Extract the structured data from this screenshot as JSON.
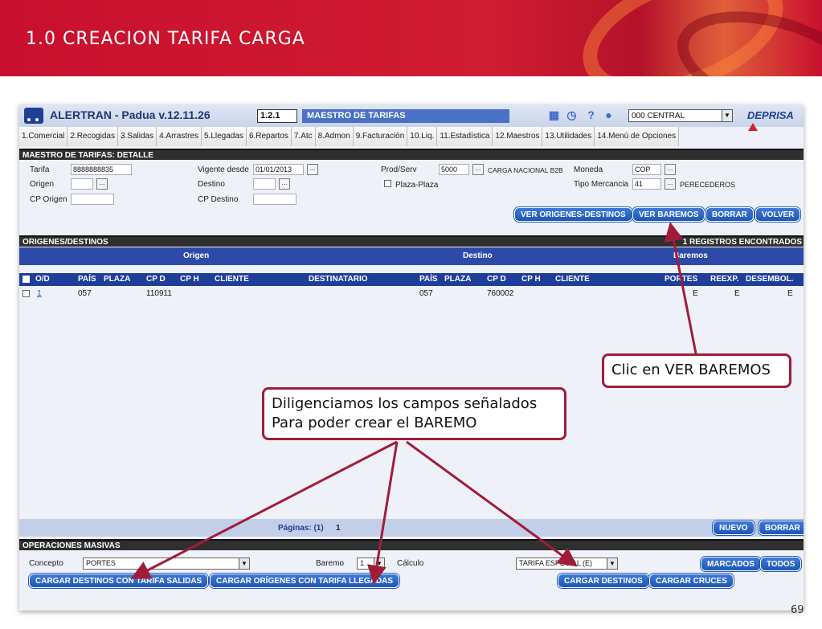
{
  "banner": {
    "title": "1.0 CREACION TARIFA CARGA"
  },
  "app": {
    "title": "ALERTRAN - Padua  v.12.11.26",
    "code": "1.2.1",
    "module": "MAESTRO DE TARIFAS",
    "office": "000 CENTRAL",
    "brand": "DEPRISA"
  },
  "menu": [
    "1.Comercial",
    "2.Recogidas",
    "3.Salidas",
    "4.Arrastres",
    "5.Llegadas",
    "6.Repartos",
    "7.Atc",
    "8.Admon",
    "9.Facturación",
    "10.Liq.",
    "11.Estadística",
    "12.Maestros",
    "13.Utilidades",
    "14.Menú de Opciones"
  ],
  "detail": {
    "header": "MAESTRO DE TARIFAS: DETALLE",
    "tarifa_label": "Tarifa",
    "tarifa_value": "8888888835",
    "origen_label": "Origen",
    "cp_origen_label": "CP Origen",
    "vigente_label": "Vigente desde",
    "vigente_value": "01/01/2013",
    "destino_label": "Destino",
    "cp_destino_label": "CP Destino",
    "prodserv_label": "Prod/Serv",
    "prodserv_value": "5000",
    "prodserv_desc": "CARGA NACIONAL B2B",
    "plaza_label": "Plaza-Plaza",
    "moneda_label": "Moneda",
    "moneda_value": "COP",
    "tipo_label": "Tipo Mercancia",
    "tipo_value": "41",
    "tipo_desc": "PERECEDEROS",
    "btn_origenes": "VER ORIGENES-DESTINOS",
    "btn_baremos": "VER BAREMOS",
    "btn_borrar": "BORRAR",
    "btn_volver": "VOLVER"
  },
  "grid": {
    "header": "ORIGENES/DESTINOS",
    "count": "1 REGISTROS ENCONTRADOS",
    "group_origen": "Origen",
    "group_destino": "Destino",
    "group_baremos": "Baremos",
    "columns": [
      "O/D",
      "PAÍS",
      "PLAZA",
      "CP D",
      "CP H",
      "CLIENTE",
      "DESTINATARIO",
      "PAÍS",
      "PLAZA",
      "CP D",
      "CP H",
      "CLIENTE",
      "PORTES",
      "REEXP.",
      "DESEMBOL."
    ],
    "row": {
      "od": "1",
      "pais_o": "057",
      "cpd_o": "110911",
      "pais_d": "057",
      "cpd_d": "760002",
      "portes": "E",
      "reexp": "E",
      "desembol": "E"
    },
    "pages_label": "Páginas: (1)",
    "page": "1",
    "btn_nuevo": "NUEVO",
    "btn_borrar": "BORRAR"
  },
  "mass": {
    "header": "OPERACIONES MASIVAS",
    "concepto_label": "Concepto",
    "concepto_value": "PORTES",
    "baremo_label": "Baremo",
    "baremo_value": "1",
    "calculo_label": "Cálculo",
    "calculo_value": "TARIFA ESPECIAL (E)",
    "btn_marcados": "MARCADOS",
    "btn_todos": "TODOS",
    "btn_cargar_dest_salidas": "CARGAR DESTINOS CON TARIFA SALIDAS",
    "btn_cargar_orig_llegadas": "CARGAR ORÍGENES CON TARIFA LLEGADAS",
    "btn_cargar_destinos": "CARGAR DESTINOS",
    "btn_cargar_cruces": "CARGAR CRUCES"
  },
  "callouts": {
    "c1": "Clic en VER BAREMOS",
    "c2_line1": "Diligenciamos los campos señalados",
    "c2_line2": "Para poder crear el BAREMO"
  },
  "slide_number": "69",
  "colors": {
    "banner": "#c8102e",
    "accent_blue": "#1f56b4",
    "callout_border": "#a01d3a"
  }
}
